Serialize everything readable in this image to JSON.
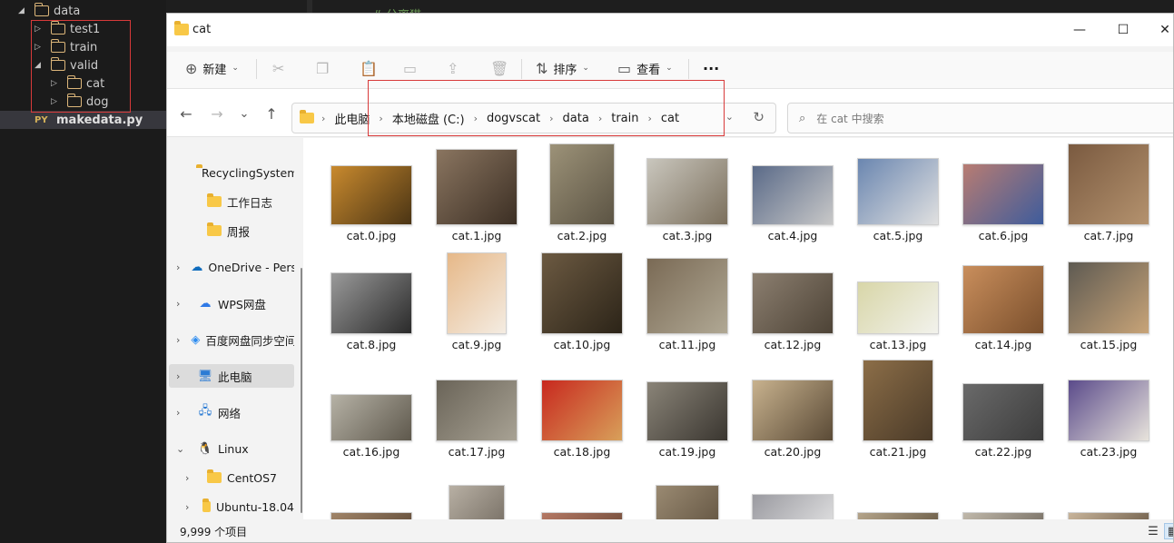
{
  "ide": {
    "tree": [
      {
        "label": "data",
        "arrow": "◢",
        "indent": 0,
        "type": "folder"
      },
      {
        "label": "test1",
        "arrow": "▷",
        "indent": 1,
        "type": "folder"
      },
      {
        "label": "train",
        "arrow": "▷",
        "indent": 1,
        "type": "folder"
      },
      {
        "label": "valid",
        "arrow": "◢",
        "indent": 1,
        "type": "folder"
      },
      {
        "label": "cat",
        "arrow": "▷",
        "indent": 2,
        "type": "folder"
      },
      {
        "label": "dog",
        "arrow": "▷",
        "indent": 2,
        "type": "folder"
      },
      {
        "label": "makedata.py",
        "badge": "PY",
        "indent": 1,
        "type": "file"
      }
    ],
    "code_snippet": "# 分离猫"
  },
  "window": {
    "title": "cat",
    "controls": {
      "minimize": "—",
      "maximize": "☐",
      "close": "✕"
    }
  },
  "toolbar": {
    "new_label": "新建",
    "new_icon": "plus-circle-icon",
    "cut_icon": "scissors-icon",
    "copy_icon": "copy-icon",
    "paste_icon": "paste-icon",
    "rename_icon": "rename-icon",
    "share_icon": "share-icon",
    "delete_icon": "trash-icon",
    "sort_label": "排序",
    "view_label": "查看",
    "more_label": "···"
  },
  "navigation": {
    "back": "←",
    "forward": "→",
    "recent": "⌄",
    "up": "↑",
    "breadcrumbs": [
      "此电脑",
      "本地磁盘 (C:)",
      "dogvscat",
      "data",
      "train",
      "cat"
    ],
    "search_placeholder": "在 cat 中搜索"
  },
  "sidebar": {
    "items": [
      {
        "label": "RecyclingSystem",
        "icon": "folder",
        "expandable": false,
        "child": true
      },
      {
        "label": "工作日志",
        "icon": "folder",
        "expandable": false,
        "child": true
      },
      {
        "label": "周报",
        "icon": "folder",
        "expandable": false,
        "child": true
      },
      {
        "label": "OneDrive - Personal",
        "icon": "☁",
        "color": "#0f6cbd",
        "expandable": true,
        "child": false
      },
      {
        "label": "WPS网盘",
        "icon": "☁",
        "color": "#2e79e6",
        "expandable": true,
        "child": false
      },
      {
        "label": "百度网盘同步空间",
        "icon": "◈",
        "color": "#2d8cf0",
        "expandable": true,
        "child": false
      },
      {
        "label": "此电脑",
        "icon": "🖥",
        "color": "#2b7bd4",
        "expandable": true,
        "child": false,
        "selected": true
      },
      {
        "label": "网络",
        "icon": "🖧",
        "color": "#2b7bd4",
        "expandable": true,
        "child": false
      },
      {
        "label": "Linux",
        "icon": "🐧",
        "color": "#222222",
        "expandable": true,
        "expanded": true,
        "child": false
      },
      {
        "label": "CentOS7",
        "icon": "folder",
        "expandable": true,
        "child": true
      },
      {
        "label": "Ubuntu-18.04",
        "icon": "folder",
        "expandable": true,
        "child": true
      }
    ]
  },
  "files": [
    {
      "name": "cat.0.jpg",
      "colors": [
        "#c98a2e",
        "#4a3414"
      ]
    },
    {
      "name": "cat.1.jpg",
      "colors": [
        "#8a7560",
        "#3c2f24"
      ]
    },
    {
      "name": "cat.2.jpg",
      "colors": [
        "#9c9278",
        "#5c5444"
      ]
    },
    {
      "name": "cat.3.jpg",
      "colors": [
        "#c9c6bd",
        "#7b6f5c"
      ]
    },
    {
      "name": "cat.4.jpg",
      "colors": [
        "#5a6a88",
        "#c8c8c8"
      ]
    },
    {
      "name": "cat.5.jpg",
      "colors": [
        "#6a86b0",
        "#e0e0e0"
      ]
    },
    {
      "name": "cat.6.jpg",
      "colors": [
        "#b87c72",
        "#3e5c9c"
      ]
    },
    {
      "name": "cat.7.jpg",
      "colors": [
        "#7a5a40",
        "#b4926e"
      ]
    },
    {
      "name": "cat.8.jpg",
      "colors": [
        "#9a9a9a",
        "#2a2a2a"
      ]
    },
    {
      "name": "cat.9.jpg",
      "colors": [
        "#e6b888",
        "#f4ece2"
      ]
    },
    {
      "name": "cat.10.jpg",
      "colors": [
        "#6c5a42",
        "#2c2418"
      ]
    },
    {
      "name": "cat.11.jpg",
      "colors": [
        "#7a6a55",
        "#b0a894"
      ]
    },
    {
      "name": "cat.12.jpg",
      "colors": [
        "#8c7f70",
        "#4d4336"
      ]
    },
    {
      "name": "cat.13.jpg",
      "colors": [
        "#d8d6a8",
        "#f2f2ec"
      ]
    },
    {
      "name": "cat.14.jpg",
      "colors": [
        "#c98e5c",
        "#7a4f2c"
      ]
    },
    {
      "name": "cat.15.jpg",
      "colors": [
        "#5e5a52",
        "#c8a478"
      ]
    },
    {
      "name": "cat.16.jpg",
      "colors": [
        "#b6b2a6",
        "#5e584c"
      ]
    },
    {
      "name": "cat.17.jpg",
      "colors": [
        "#6a6458",
        "#a8a294"
      ]
    },
    {
      "name": "cat.18.jpg",
      "colors": [
        "#c8281e",
        "#d8a05a"
      ]
    },
    {
      "name": "cat.19.jpg",
      "colors": [
        "#8a8478",
        "#3a3630"
      ]
    },
    {
      "name": "cat.20.jpg",
      "colors": [
        "#c8b28e",
        "#5a4a36"
      ]
    },
    {
      "name": "cat.21.jpg",
      "colors": [
        "#8c6e48",
        "#4a3a28"
      ]
    },
    {
      "name": "cat.22.jpg",
      "colors": [
        "#6a6a6a",
        "#3c3c3c"
      ]
    },
    {
      "name": "cat.23.jpg",
      "colors": [
        "#5a4a8a",
        "#e8e4dc"
      ]
    },
    {
      "name": "",
      "colors": [
        "#a08468",
        "#5a4634"
      ]
    },
    {
      "name": "",
      "colors": [
        "#b8b0a4",
        "#6a6258"
      ]
    },
    {
      "name": "",
      "colors": [
        "#b47864",
        "#6a4836"
      ]
    },
    {
      "name": "",
      "colors": [
        "#9a8a72",
        "#5a4c3a"
      ]
    },
    {
      "name": "",
      "colors": [
        "#9a9aa0",
        "#ececec"
      ]
    },
    {
      "name": "",
      "colors": [
        "#b4a48a",
        "#5c4e3a"
      ]
    },
    {
      "name": "",
      "colors": [
        "#c0b8aa",
        "#6a6258"
      ]
    },
    {
      "name": "",
      "colors": [
        "#c8b49a",
        "#5e4e3c"
      ]
    }
  ],
  "status": {
    "count_text": "9,999 个项目",
    "details_view_icon": "details-view-icon",
    "large_icons_view_icon": "large-icons-view-icon"
  }
}
